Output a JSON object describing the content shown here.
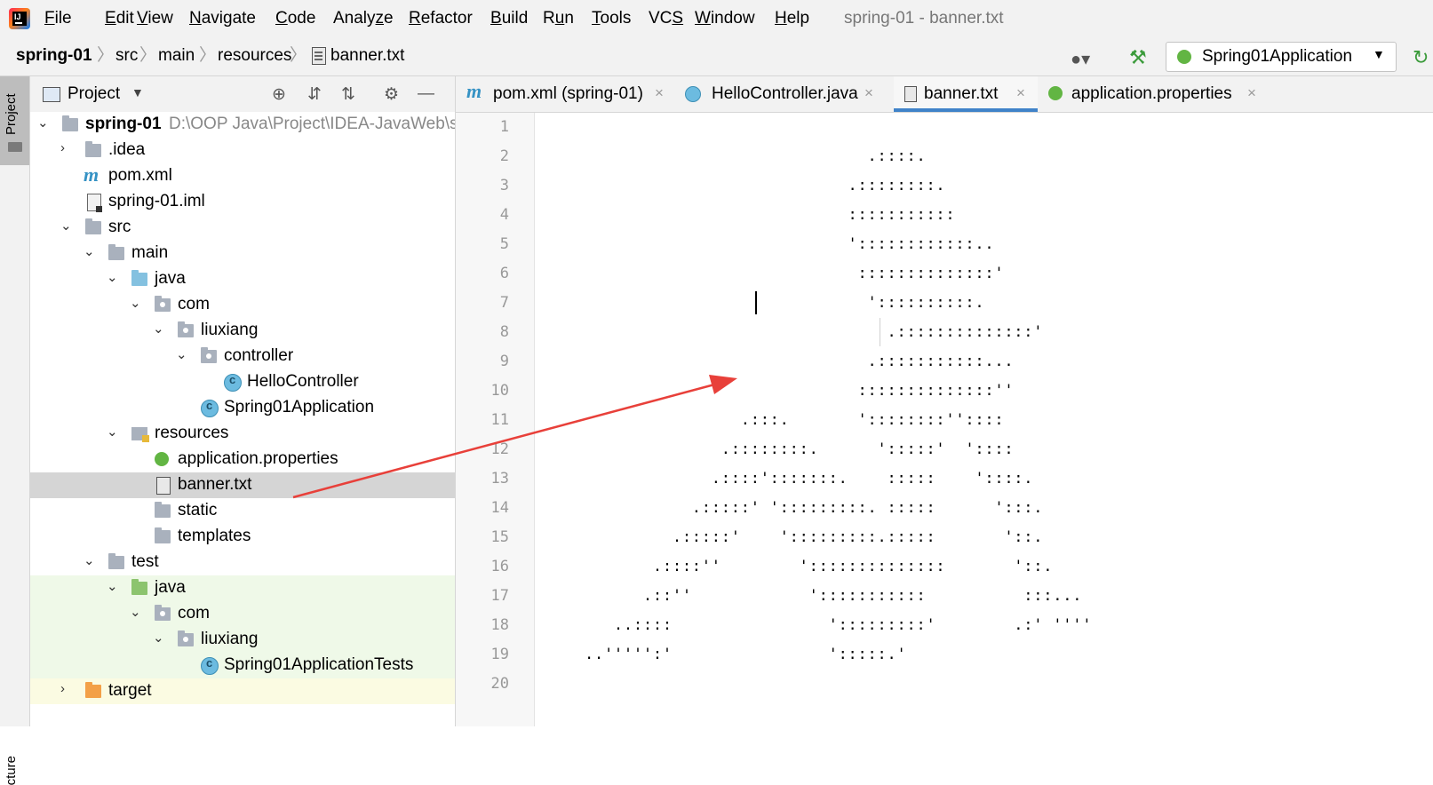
{
  "window_title": "spring-01 - banner.txt",
  "menu": [
    {
      "pre": "",
      "u": "F",
      "post": "ile"
    },
    {
      "pre": "",
      "u": "E",
      "post": "dit"
    },
    {
      "pre": "",
      "u": "V",
      "post": "iew"
    },
    {
      "pre": "",
      "u": "N",
      "post": "avigate"
    },
    {
      "pre": "",
      "u": "C",
      "post": "ode"
    },
    {
      "pre": "Analy",
      "u": "z",
      "post": "e"
    },
    {
      "pre": "",
      "u": "R",
      "post": "efactor"
    },
    {
      "pre": "",
      "u": "B",
      "post": "uild"
    },
    {
      "pre": "R",
      "u": "u",
      "post": "n"
    },
    {
      "pre": "",
      "u": "T",
      "post": "ools"
    },
    {
      "pre": "VC",
      "u": "S",
      "post": ""
    },
    {
      "pre": "",
      "u": "W",
      "post": "indow"
    },
    {
      "pre": "",
      "u": "H",
      "post": "elp"
    }
  ],
  "breadcrumb": [
    "spring-01",
    "src",
    "main",
    "resources",
    "banner.txt"
  ],
  "run_config": {
    "label": "Spring01Application"
  },
  "icons": {
    "app_logo": "intellij-logo-icon",
    "user": "user-icon",
    "build": "hammer-icon",
    "rerun": "rerun-icon"
  },
  "project_panel": {
    "title": "Project",
    "root_path": "D:\\OOP Java\\Project\\IDEA-JavaWeb\\s",
    "tree": [
      {
        "label": "spring-01",
        "bold": true
      },
      {
        "label": ".idea"
      },
      {
        "label": "pom.xml"
      },
      {
        "label": "spring-01.iml"
      },
      {
        "label": "src"
      },
      {
        "label": "main"
      },
      {
        "label": "java"
      },
      {
        "label": "com"
      },
      {
        "label": "liuxiang"
      },
      {
        "label": "controller"
      },
      {
        "label": "HelloController"
      },
      {
        "label": "Spring01Application"
      },
      {
        "label": "resources"
      },
      {
        "label": "application.properties"
      },
      {
        "label": "banner.txt"
      },
      {
        "label": "static"
      },
      {
        "label": "templates"
      },
      {
        "label": "test"
      },
      {
        "label": "java"
      },
      {
        "label": "com"
      },
      {
        "label": "liuxiang"
      },
      {
        "label": "Spring01ApplicationTests"
      },
      {
        "label": "target"
      }
    ]
  },
  "left_stripe": {
    "project": "Project",
    "structure": "cture"
  },
  "tabs": [
    {
      "label": "pom.xml (spring-01)",
      "close": "×"
    },
    {
      "label": "HelloController.java",
      "close": "×"
    },
    {
      "label": "banner.txt",
      "close": "×",
      "active": true
    },
    {
      "label": "application.properties",
      "close": "×"
    }
  ],
  "editor": {
    "line_numbers": [
      "1",
      "2",
      "3",
      "4",
      "5",
      "6",
      "7",
      "8",
      "9",
      "10",
      "11",
      "12",
      "13",
      "14",
      "15",
      "16",
      "17",
      "18",
      "19",
      "20"
    ],
    "lines": [
      "",
      "                               .::::.",
      "                             .::::::::.",
      "                             :::::::::::",
      "                             '::::::::::::..",
      "                              ::::::::::::::'",
      "                               '::::::::::.",
      "                                 .::::::::::::::'",
      "                               .:::::::::::...",
      "                              ::::::::::::::''",
      "                  .:::.       '::::::::''::::",
      "                .::::::::.      ':::::'  '::::",
      "               .::::':::::::.    :::::    '::::.",
      "             .:::::' ':::::::::. :::::      ':::.",
      "           .:::::'    ':::::::::.:::::       '::.",
      "         .::::''        '::::::::::::::       '::.",
      "        .::''            ':::::::::::          :::...",
      "     ..::::                ':::::::::'        .:' ''''",
      "  ..''''':'                ':::::.'",
      ""
    ]
  }
}
